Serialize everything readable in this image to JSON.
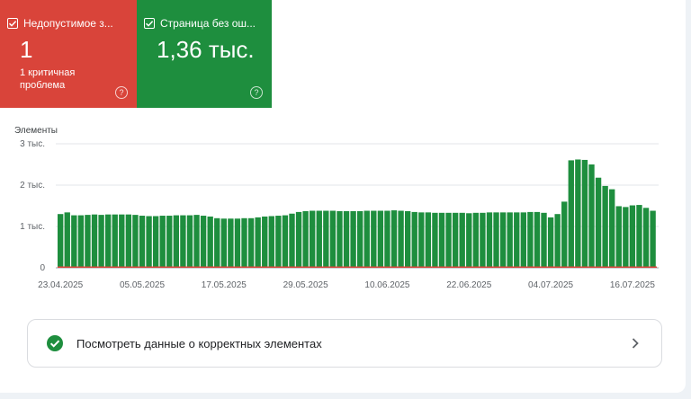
{
  "tiles": [
    {
      "label": "Недопустимое з...",
      "value": "1",
      "sub": "1 критичная проблема",
      "color": "#d9443a"
    },
    {
      "label": "Страница без ош...",
      "value": "1,36 тыс.",
      "sub": "",
      "color": "#1e8e3e"
    }
  ],
  "chart_label": "Элементы",
  "link_label": "Посмотреть данные о корректных элементах",
  "chart_data": {
    "type": "bar",
    "y_ticks": [
      "0",
      "1 тыс.",
      "2 тыс.",
      "3 тыс."
    ],
    "y_tick_values": [
      0,
      1000,
      2000,
      3000
    ],
    "ylim": [
      0,
      3000
    ],
    "x_tick_labels": [
      "23.04.2025",
      "05.05.2025",
      "17.05.2025",
      "29.05.2025",
      "10.06.2025",
      "22.06.2025",
      "04.07.2025",
      "16.07.2025"
    ],
    "x_tick_indices": [
      0,
      12,
      24,
      36,
      48,
      60,
      72,
      84
    ],
    "series": [
      {
        "color": "#1e8e3e",
        "values": [
          1300,
          1340,
          1270,
          1270,
          1280,
          1290,
          1280,
          1290,
          1290,
          1290,
          1290,
          1280,
          1260,
          1250,
          1250,
          1260,
          1260,
          1270,
          1270,
          1270,
          1280,
          1260,
          1240,
          1200,
          1190,
          1190,
          1190,
          1200,
          1200,
          1220,
          1240,
          1250,
          1260,
          1270,
          1310,
          1350,
          1370,
          1380,
          1380,
          1380,
          1380,
          1370,
          1370,
          1370,
          1370,
          1380,
          1380,
          1380,
          1380,
          1390,
          1380,
          1370,
          1350,
          1340,
          1340,
          1330,
          1330,
          1330,
          1330,
          1330,
          1320,
          1330,
          1330,
          1340,
          1340,
          1340,
          1340,
          1340,
          1340,
          1350,
          1350,
          1330,
          1220,
          1300,
          1600,
          2600,
          2620,
          2610,
          2500,
          2180,
          1980,
          1900,
          1490,
          1470,
          1510,
          1520,
          1450,
          1380
        ]
      },
      {
        "color": "#d9443a",
        "values": [
          1,
          1,
          1,
          1,
          1,
          1,
          1,
          1,
          1,
          1,
          1,
          1,
          1,
          1,
          1,
          1,
          1,
          1,
          1,
          1,
          1,
          1,
          1,
          1,
          1,
          1,
          1,
          1,
          1,
          1,
          1,
          1,
          1,
          1,
          1,
          1,
          1,
          1,
          1,
          1,
          1,
          1,
          1,
          1,
          1,
          1,
          1,
          1,
          1,
          1,
          1,
          1,
          1,
          1,
          1,
          1,
          1,
          1,
          1,
          1,
          1,
          1,
          1,
          1,
          1,
          1,
          1,
          1,
          1,
          1,
          1,
          1,
          1,
          1,
          1,
          1,
          1,
          1,
          1,
          1,
          1,
          1,
          1,
          1,
          1,
          1,
          1,
          1
        ]
      }
    ]
  }
}
